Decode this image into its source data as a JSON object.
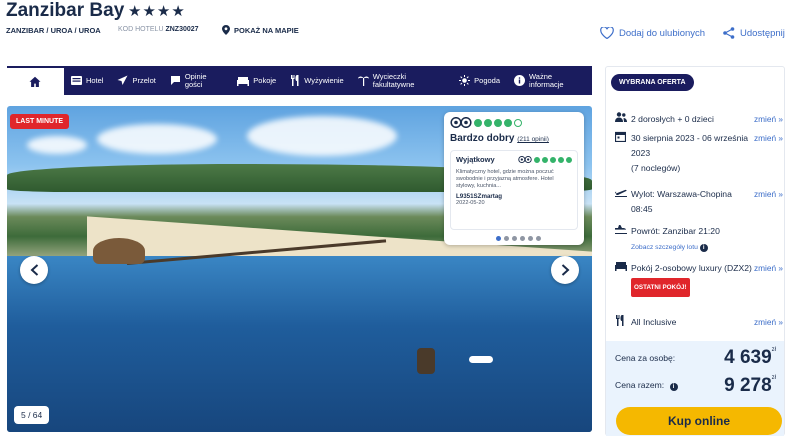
{
  "header": {
    "title": "Zanzibar Bay",
    "stars": "★★★★",
    "breadcrumb": "ZANZIBAR / UROA / UROA",
    "hotel_code_label": "KOD HOTELU",
    "hotel_code": "ZNZ30027",
    "map_link": "POKAŻ NA MAPIE",
    "favorite": "Dodaj do ulubionych",
    "share": "Udostępnij"
  },
  "nav": {
    "items": [
      {
        "label": "Hotel",
        "icon": "hotel-icon"
      },
      {
        "label": "Przelot",
        "icon": "plane-icon"
      },
      {
        "label": "Opinie gości",
        "icon": "chat-icon"
      },
      {
        "label": "Pokoje",
        "icon": "bed-icon"
      },
      {
        "label": "Wyżywienie",
        "icon": "cutlery-icon"
      },
      {
        "label": "Wycieczki fakultatywne",
        "icon": "palm-icon"
      },
      {
        "label": "Pogoda",
        "icon": "sun-icon"
      },
      {
        "label": "Ważne informacje",
        "icon": "info-icon"
      }
    ]
  },
  "gallery": {
    "badge": "LAST MINUTE",
    "counter": "5 / 64",
    "review": {
      "rating_label": "Bardzo dobry",
      "rating_count": "(211 opinii)",
      "card_title": "Wyjątkowy",
      "card_text": "Klimatyczny hotel, gdzie można poczuć swobodnie i przyjazną atmosfere. Hotel stylowy, kuchnia...",
      "card_author": "L9351SZmartag",
      "card_date": "2022-05-20"
    }
  },
  "offer": {
    "tag": "WYBRANA OFERTA",
    "change_label": "zmień »",
    "guests": "2 dorosłych + 0 dzieci",
    "dates": "30 sierpnia 2023 - 06 września 2023",
    "nights": "(7 noclegów)",
    "departure": "Wylot: Warszawa-Chopina 08:45",
    "return": "Powrót: Zanzibar 21:20",
    "flight_details": "Zobacz szczegóły lotu",
    "room": "Pokój 2-osobowy luxury (DZX2)",
    "last_room": "OSTATNI POKÓJ!",
    "board": "All Inclusive",
    "price_per_person_label": "Cena za osobę:",
    "price_per_person": "4 639",
    "price_total_label": "Cena razem:",
    "price_total": "9 278",
    "currency": "zł",
    "buy_button": "Kup online"
  },
  "colors": {
    "navy": "#1a1c5e",
    "link": "#3d6ec9",
    "badge_red": "#e0262b",
    "buy_yellow": "#f5b800",
    "tripadvisor_green": "#34b36a"
  }
}
